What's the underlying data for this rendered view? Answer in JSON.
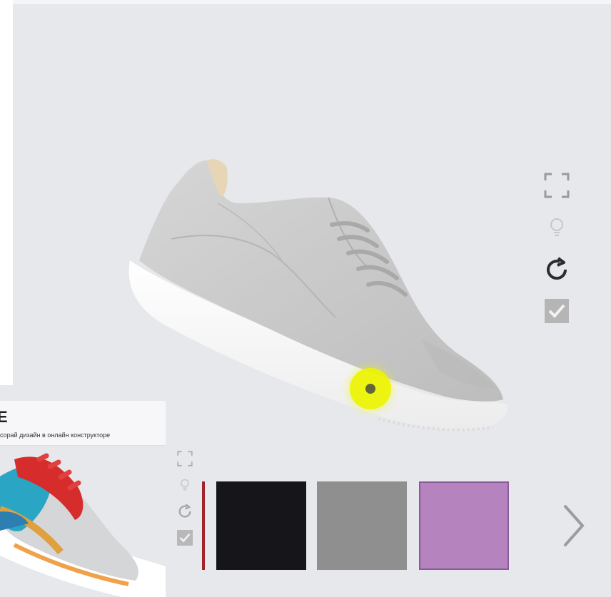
{
  "inset": {
    "title_letter": "Е",
    "caption": "сорай дизайн в онлайн конструкторе"
  },
  "colors": {
    "hotspot": "#eef500",
    "swatch_black": "#16151a",
    "swatch_gray": "#8f8f8f",
    "swatch_purple": "#b583bd",
    "active_marker": "#a1232b"
  },
  "icons": {
    "main_toolbar": [
      "fullscreen-icon",
      "light-bulb-icon",
      "rotate-icon",
      "checkbox-icon"
    ],
    "inset_toolbar": [
      "fullscreen-icon",
      "light-bulb-icon",
      "rotate-icon",
      "checkbox-icon"
    ],
    "pagination": "chevron-right-icon"
  }
}
